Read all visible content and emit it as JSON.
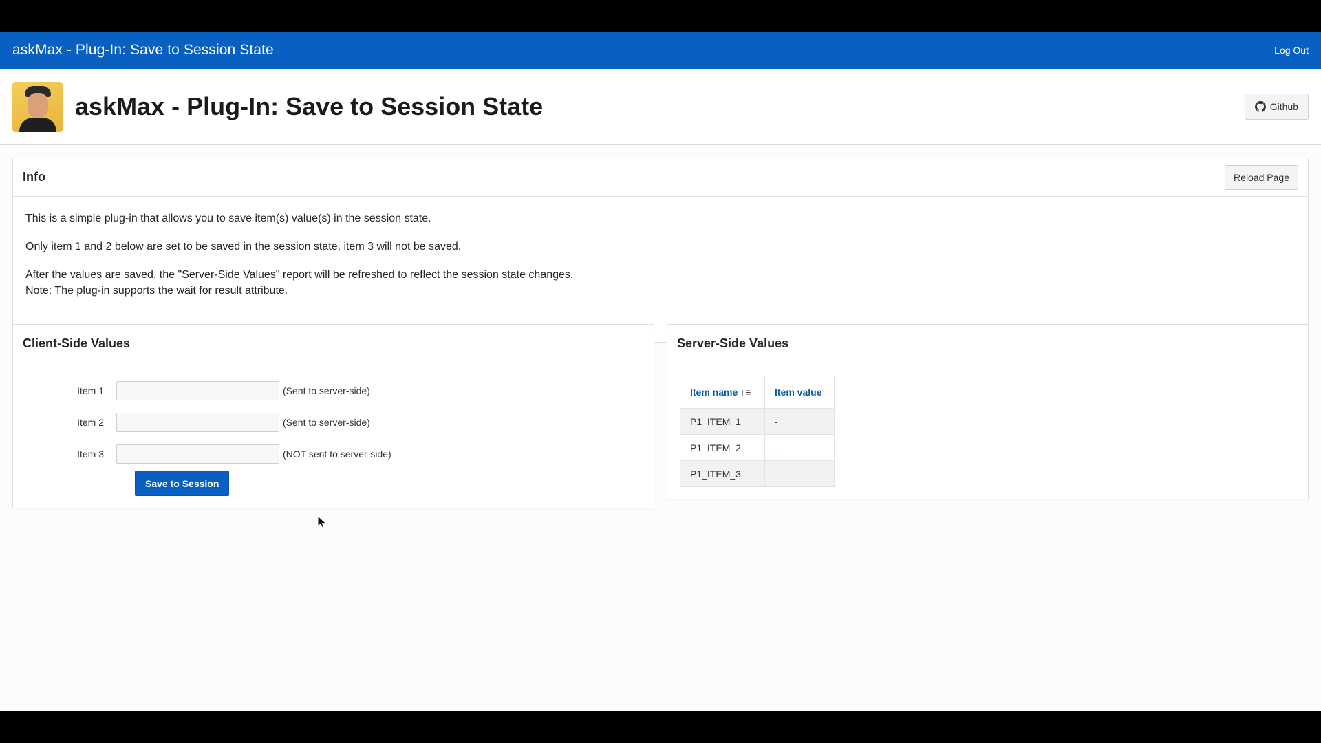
{
  "topbar": {
    "app_title": "askMax - Plug-In: Save to Session State",
    "logout_label": "Log Out"
  },
  "hero": {
    "page_title": "askMax - Plug-In: Save to Session State",
    "github_label": "Github",
    "github_icon": "github-icon"
  },
  "info": {
    "title": "Info",
    "reload_label": "Reload Page",
    "lines": [
      "This is a simple plug-in that allows you to save item(s) value(s) in the session state.",
      "Only item 1 and 2 below are set to be saved in the session state, item 3 will not be saved.",
      "After the values are saved, the \"Server-Side Values\" report will be refreshed to reflect the session state changes.",
      "Note: The plug-in supports the wait for result attribute."
    ]
  },
  "client": {
    "title": "Client-Side Values",
    "items": [
      {
        "label": "Item 1",
        "value": "",
        "hint": "(Sent to server-side)"
      },
      {
        "label": "Item 2",
        "value": "",
        "hint": "(Sent to server-side)"
      },
      {
        "label": "Item 3",
        "value": "",
        "hint": "(NOT sent to server-side)"
      }
    ],
    "save_label": "Save to Session"
  },
  "server": {
    "title": "Server-Side Values",
    "columns": [
      "Item name",
      "Item value"
    ],
    "sort_icon": "sort-ascending-icon",
    "rows": [
      {
        "name": "P1_ITEM_1",
        "value": "-"
      },
      {
        "name": "P1_ITEM_2",
        "value": "-"
      },
      {
        "name": "P1_ITEM_3",
        "value": "-"
      }
    ]
  },
  "colors": {
    "brand": "#0860c2",
    "link": "#0b5aad",
    "page_bg": "#fcfcfc"
  }
}
